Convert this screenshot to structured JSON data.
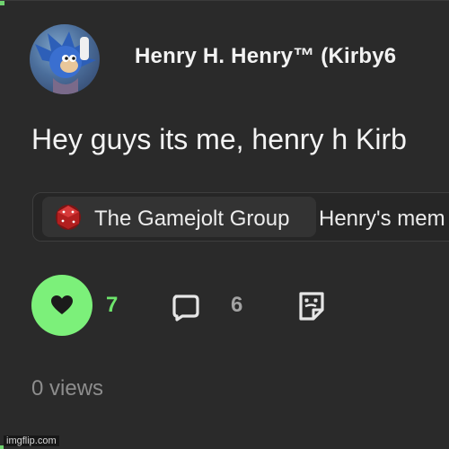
{
  "post": {
    "author_name": "Henry H. Henry™ (Kirby6",
    "text": "Hey guys its me, henry h Kirb",
    "community": "The Gamejolt Group",
    "channel": "Henry's mem",
    "like_count": "7",
    "comment_count": "6",
    "views": "0 views"
  },
  "watermark": "imgflip.com",
  "colors": {
    "background": "#2a2a2a",
    "like_accent": "#7cf07a",
    "like_count": "#6ee56c",
    "muted": "#8d8d8d"
  },
  "icons": {
    "like": "heart-icon",
    "comment": "comment-bubble-icon",
    "sticker": "sticker-icon",
    "community": "community-dice-icon"
  }
}
